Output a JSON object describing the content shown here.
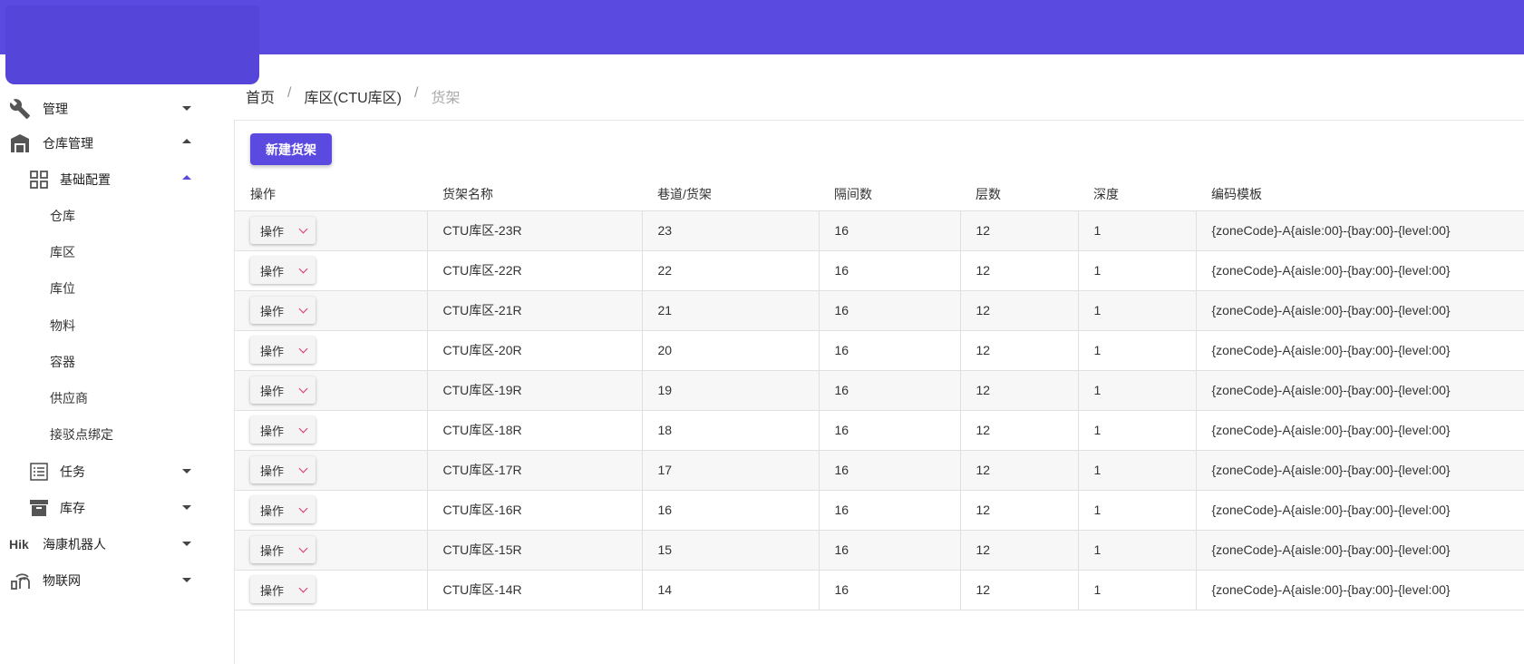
{
  "breadcrumb": {
    "home": "首页",
    "zone": "库区(CTU库区)",
    "current": "货架",
    "sep": "/"
  },
  "sidebar": {
    "manage": "管理",
    "warehouse_mgmt": "仓库管理",
    "basic_config": "基础配置",
    "sub_items": [
      "仓库",
      "库区",
      "库位",
      "物料",
      "容器",
      "供应商",
      "接驳点绑定"
    ],
    "task": "任务",
    "inventory": "库存",
    "hik_prefix": "Hik",
    "hik": "海康机器人",
    "iot": "物联网"
  },
  "toolbar": {
    "new_button": "新建货架"
  },
  "table": {
    "headers": [
      "操作",
      "货架名称",
      "巷道/货架",
      "隔间数",
      "层数",
      "深度",
      "编码模板"
    ],
    "op_label": "操作",
    "rows": [
      [
        "CTU库区-23R",
        "23",
        "16",
        "12",
        "1",
        "{zoneCode}-A{aisle:00}-{bay:00}-{level:00}"
      ],
      [
        "CTU库区-22R",
        "22",
        "16",
        "12",
        "1",
        "{zoneCode}-A{aisle:00}-{bay:00}-{level:00}"
      ],
      [
        "CTU库区-21R",
        "21",
        "16",
        "12",
        "1",
        "{zoneCode}-A{aisle:00}-{bay:00}-{level:00}"
      ],
      [
        "CTU库区-20R",
        "20",
        "16",
        "12",
        "1",
        "{zoneCode}-A{aisle:00}-{bay:00}-{level:00}"
      ],
      [
        "CTU库区-19R",
        "19",
        "16",
        "12",
        "1",
        "{zoneCode}-A{aisle:00}-{bay:00}-{level:00}"
      ],
      [
        "CTU库区-18R",
        "18",
        "16",
        "12",
        "1",
        "{zoneCode}-A{aisle:00}-{bay:00}-{level:00}"
      ],
      [
        "CTU库区-17R",
        "17",
        "16",
        "12",
        "1",
        "{zoneCode}-A{aisle:00}-{bay:00}-{level:00}"
      ],
      [
        "CTU库区-16R",
        "16",
        "16",
        "12",
        "1",
        "{zoneCode}-A{aisle:00}-{bay:00}-{level:00}"
      ],
      [
        "CTU库区-15R",
        "15",
        "16",
        "12",
        "1",
        "{zoneCode}-A{aisle:00}-{bay:00}-{level:00}"
      ],
      [
        "CTU库区-14R",
        "14",
        "16",
        "12",
        "1",
        "{zoneCode}-A{aisle:00}-{bay:00}-{level:00}"
      ]
    ]
  },
  "colors": {
    "primary": "#5b4ae0",
    "chevron": "#e0306a"
  }
}
